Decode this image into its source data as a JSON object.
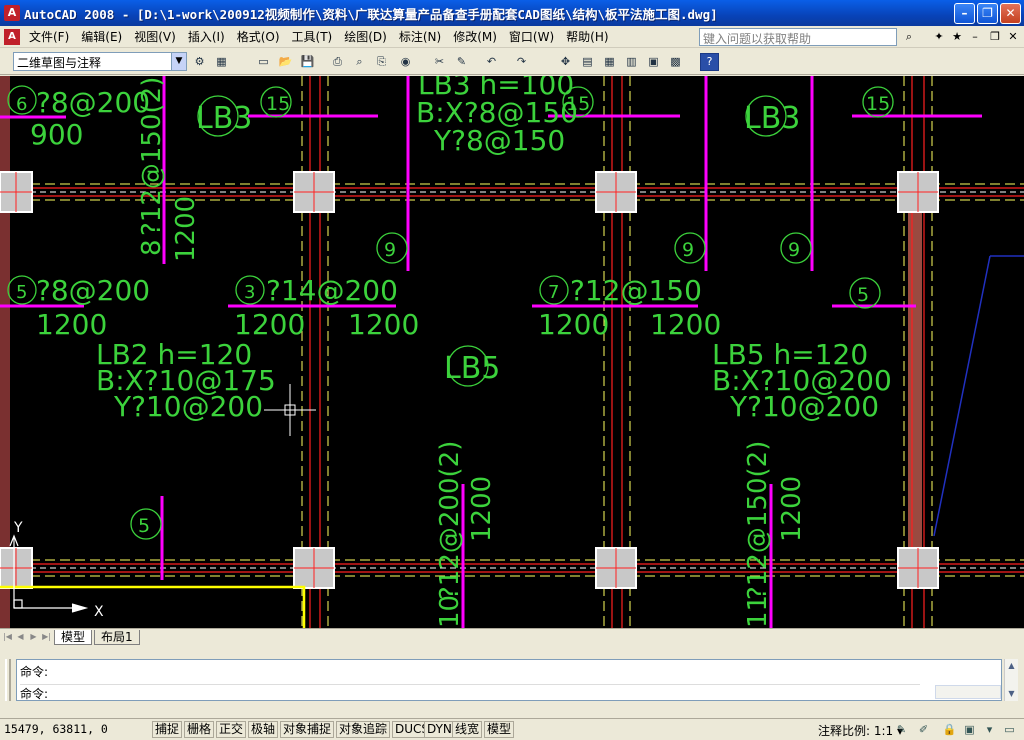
{
  "window": {
    "app_icon": "A",
    "title": "AutoCAD 2008 - [D:\\1-work\\200912视频制作\\资料\\广联达算量产品备查手册配套CAD图纸\\结构\\板平法施工图.dwg]",
    "buttons": [
      "minimize-icon",
      "restore-icon",
      "close-icon"
    ]
  },
  "menubar": {
    "items": [
      "文件(F)",
      "编辑(E)",
      "视图(V)",
      "插入(I)",
      "格式(O)",
      "工具(T)",
      "绘图(D)",
      "标注(N)",
      "修改(M)",
      "窗口(W)",
      "帮助(H)"
    ],
    "help_placeholder": "键入问题以获取帮助"
  },
  "toolbar": {
    "workspace": "二维草图与注释",
    "icons": [
      "gear-icon",
      "toolbar-icon",
      "new-icon",
      "open-icon",
      "save-icon",
      "plot-icon",
      "preview-icon",
      "publish-icon",
      "3d-icon",
      "cut-icon",
      "matchprop-icon",
      "undo-icon",
      "redo-icon",
      "pan-icon",
      "zoom-icon",
      "properties-icon",
      "designcenter-icon",
      "toolpalette-icon",
      "sheetset-icon",
      "markup-icon",
      "calculator-icon",
      "help-icon"
    ]
  },
  "drawing": {
    "labels": {
      "n6": "6",
      "rebar6": "?8@200",
      "span900": "900",
      "lb3a": "LB3",
      "n15a": "15",
      "lb3h": "LB3  h=100",
      "lb3bx": "B:X?8@150",
      "lb3y": "Y?8@150",
      "n15b": "15",
      "lb3b": "LB3",
      "n15c": "15",
      "v8": "8",
      "v8rebar": "?12@150(2)",
      "v8len": "1200",
      "n9a": "9",
      "n9b": "9",
      "n9c": "9",
      "n5a": "5",
      "rebar5": "?8@200",
      "len5": "1200",
      "n3": "3",
      "rebar3": "?14@200",
      "len3a": "1200",
      "len3b": "1200",
      "n7": "7",
      "rebar7": "?12@150",
      "len7a": "1200",
      "len7b": "1200",
      "n5b": "5",
      "lb2h": "LB2  h=120",
      "lb2bx": "B:X?10@175",
      "lb2y": "Y?10@200",
      "lb5a": "LB5",
      "lb5h": "LB5  h=120",
      "lb5bx": "B:X?10@200",
      "lb5y": "Y?10@200",
      "n10": "10",
      "v10rebar": "?12@200(2)",
      "v10len": "1200",
      "n11": "11",
      "v11rebar": "?12@150(2)",
      "v11len": "1200",
      "n5c": "5",
      "axis_y": "Y",
      "axis_x": "X"
    }
  },
  "tabs": {
    "items": [
      "模型",
      "布局1"
    ]
  },
  "command": {
    "line1": "命令:",
    "line2": "命令:"
  },
  "status": {
    "coords": "15479, 63811, 0",
    "toggles": [
      "捕捉",
      "栅格",
      "正交",
      "极轴",
      "对象捕捉",
      "对象追踪",
      "DUCS",
      "DYN",
      "线宽",
      "模型"
    ],
    "scale_label": "注释比例:",
    "scale_value": "1:1 ▾"
  },
  "colors": {
    "magenta": "#ff00ff",
    "green": "#3cd23c",
    "column": "#c8c8c8",
    "beam_red": "#ff2020",
    "axis_dash": "#ffff60"
  }
}
